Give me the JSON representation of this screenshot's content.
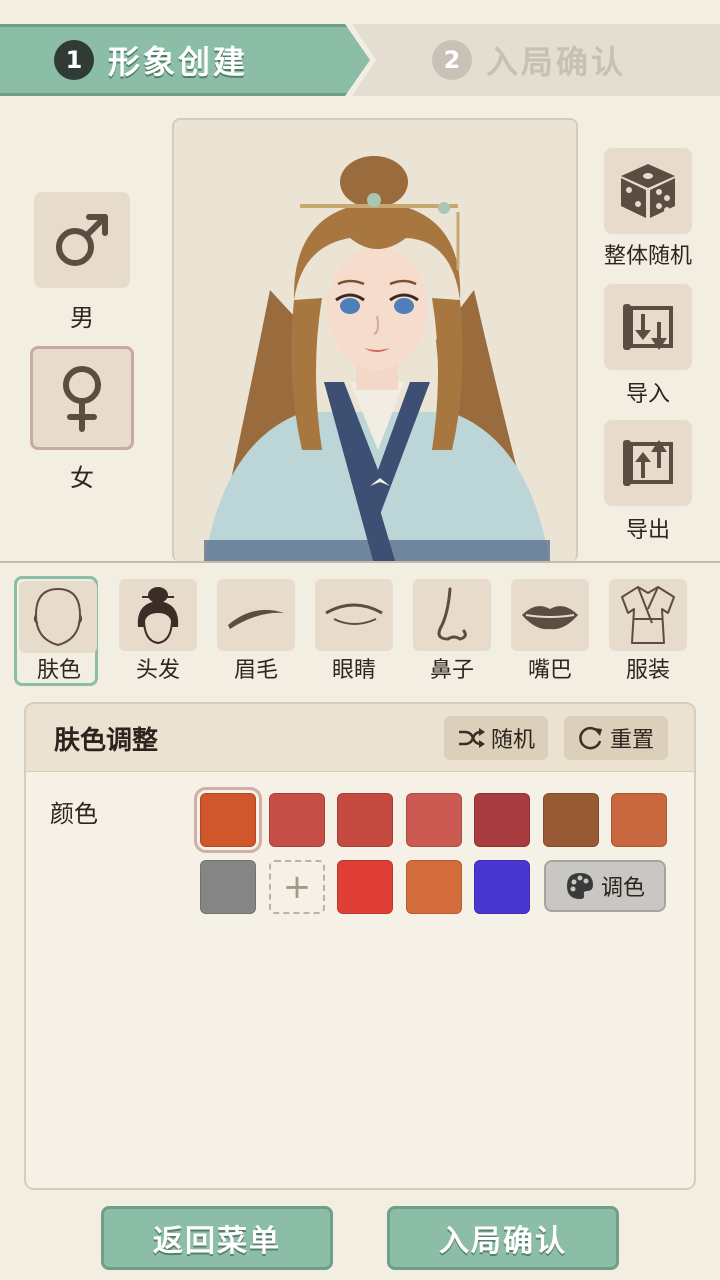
{
  "steps": [
    {
      "num": "1",
      "label": "形象创建"
    },
    {
      "num": "2",
      "label": "入局确认"
    }
  ],
  "gender": {
    "male_label": "男",
    "female_label": "女",
    "selected": "female"
  },
  "actions": {
    "random_all": "整体随机",
    "import": "导入",
    "export": "导出"
  },
  "tabs": [
    {
      "label": "肤色",
      "icon": "face-outline-icon"
    },
    {
      "label": "头发",
      "icon": "hair-bun-icon"
    },
    {
      "label": "眉毛",
      "icon": "eyebrow-icon"
    },
    {
      "label": "眼睛",
      "icon": "eye-icon"
    },
    {
      "label": "鼻子",
      "icon": "nose-icon"
    },
    {
      "label": "嘴巴",
      "icon": "lips-icon"
    },
    {
      "label": "服装",
      "icon": "robe-icon"
    }
  ],
  "panel": {
    "title": "肤色调整",
    "random_label": "随机",
    "reset_label": "重置",
    "color_label": "颜色",
    "custom_label": "调色",
    "swatches_row1": [
      "#d0562c",
      "#c54f47",
      "#c44940",
      "#cb5a52",
      "#a83c40",
      "#985a34",
      "#c9683e"
    ],
    "swatches_row2": [
      "#858585",
      "#df3f36",
      "#d36d3c",
      "#4a36d0"
    ],
    "selected_index": 0
  },
  "bottom": {
    "back_label": "返回菜单",
    "confirm_label": "入局确认"
  }
}
